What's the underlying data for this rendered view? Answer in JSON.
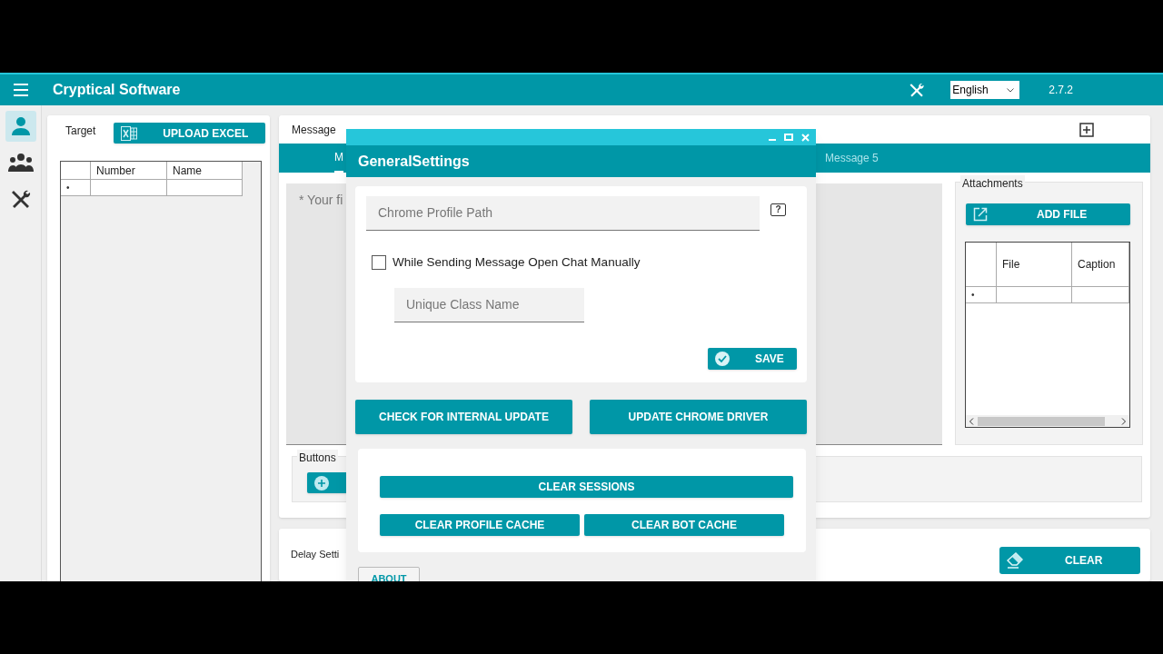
{
  "app_bar": {
    "title": "Cryptical Software",
    "language": "English",
    "version": "2.7.2"
  },
  "sidebar": {
    "items": [
      {
        "selected": true
      },
      {
        "selected": false
      },
      {
        "selected": false
      }
    ]
  },
  "target": {
    "label": "Target",
    "upload_button": "UPLOAD EXCEL",
    "table": {
      "columns": [
        "Number",
        "Name"
      ],
      "new_row_marker": "•"
    }
  },
  "message": {
    "label": "Message",
    "tabs": [
      {
        "label": "M",
        "selected": true
      },
      {
        "label": "Message 5",
        "selected": false
      }
    ],
    "text_placeholder": "* Your fi",
    "buttons_group": {
      "label": "Buttons"
    },
    "attachments": {
      "label": "Attachments",
      "add_button": "ADD FILE",
      "table": {
        "columns": [
          "File",
          "Caption"
        ],
        "new_row_marker": "•"
      }
    }
  },
  "delay_settings": {
    "label": "Delay Setti",
    "clear_button": "CLEAR"
  },
  "dialog": {
    "title": "GeneralSettings",
    "profile_path": {
      "placeholder": "Chrome Profile Path"
    },
    "help_button": "?",
    "open_chat_manually": {
      "label": "While Sending Message Open Chat Manually",
      "checked": false
    },
    "class_name": {
      "placeholder": "Unique Class Name"
    },
    "save_button": "SAVE",
    "actions": [
      "CHECK FOR INTERNAL UPDATE",
      "UPDATE CHROME DRIVER"
    ],
    "clear_buttons": [
      "CLEAR SESSIONS",
      "CLEAR PROFILE CACHE",
      "CLEAR BOT CACHE"
    ],
    "about_button": "ABOUT"
  }
}
